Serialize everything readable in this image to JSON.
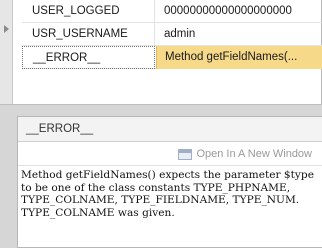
{
  "variables": {
    "rows": [
      {
        "name": "USER_LOGGED",
        "value": "00000000000000000000"
      },
      {
        "name": "USR_USERNAME",
        "value": "admin"
      },
      {
        "name": "__ERROR__",
        "value": "Method getFieldNames(..."
      }
    ]
  },
  "detail": {
    "title": "__ERROR__",
    "open_label": "Open In A New Window",
    "text": "Method getFieldNames() expects the parameter $type to be one of the class constants TYPE_PHPNAME, TYPE_COLNAME, TYPE_FIELDNAME, TYPE_NUM. TYPE_COLNAME was given."
  },
  "colors": {
    "selected_value_bg": "#f7d98a"
  }
}
